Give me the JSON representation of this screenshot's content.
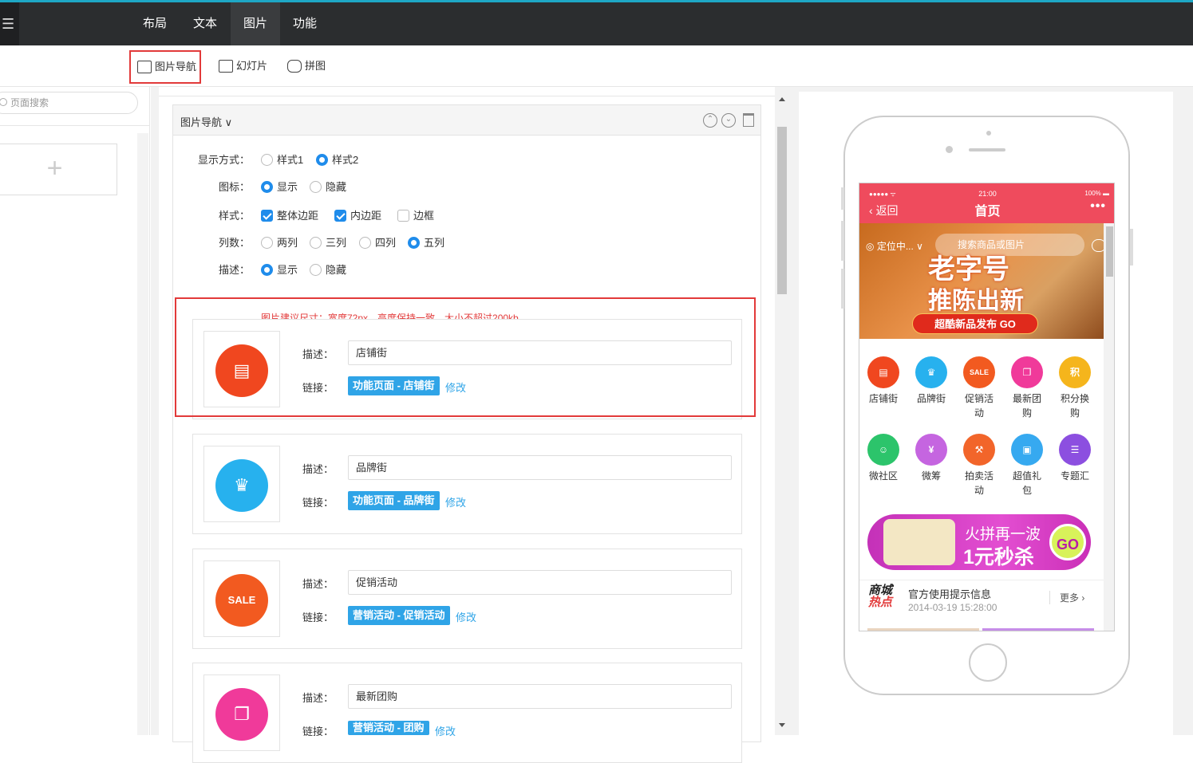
{
  "topbar": {
    "menu_icon": "list-icon",
    "tabs": [
      {
        "label": "布局"
      },
      {
        "label": "文本"
      },
      {
        "label": "图片"
      },
      {
        "label": "功能"
      }
    ],
    "active_tab": "图片"
  },
  "subbar": {
    "items": [
      {
        "label": "图片导航",
        "icon": "image-nav-icon"
      },
      {
        "label": "幻灯片",
        "icon": "slideshow-icon"
      },
      {
        "label": "拼图",
        "icon": "puzzle-icon"
      }
    ]
  },
  "left": {
    "search_placeholder": "页面搜索",
    "add_symbol": "+"
  },
  "panel": {
    "title": "图片导航",
    "rows": {
      "display_mode": {
        "label": "显示方式：",
        "options": [
          "样式1",
          "样式2"
        ],
        "selected": "样式2"
      },
      "icon": {
        "label": "图标：",
        "options": [
          "显示",
          "隐藏"
        ],
        "selected": "显示"
      },
      "style": {
        "label": "样式：",
        "options": [
          "整体边距",
          "内边距",
          "边框"
        ],
        "checked": [
          "整体边距",
          "内边距"
        ]
      },
      "columns": {
        "label": "列数：",
        "options": [
          "两列",
          "三列",
          "四列",
          "五列"
        ],
        "selected": "五列"
      },
      "desc": {
        "label": "描述：",
        "options": [
          "显示",
          "隐藏"
        ],
        "selected": "显示"
      }
    },
    "hint": "图片建议尺寸：宽度72px，高度保持一致，大小不超过200kb",
    "items": [
      {
        "desc_label": "描述：",
        "desc_value": "店铺街",
        "link_label": "链接：",
        "link_tag": "功能页面 - 店铺街",
        "edit": "修改",
        "color": "#f0471f",
        "icon": "store-icon",
        "glyph": "▤"
      },
      {
        "desc_label": "描述：",
        "desc_value": "品牌街",
        "link_label": "链接：",
        "link_tag": "功能页面 - 品牌街",
        "edit": "修改",
        "color": "#27b1ee",
        "icon": "crown-icon",
        "glyph": "♛"
      },
      {
        "desc_label": "描述：",
        "desc_value": "促销活动",
        "link_label": "链接：",
        "link_tag": "营销活动 - 促销活动",
        "edit": "修改",
        "color": "#f25a20",
        "icon": "sale-icon",
        "glyph": "SALE"
      },
      {
        "desc_label": "描述：",
        "desc_value": "最新团购",
        "link_label": "链接：",
        "link_tag": "营销活动 - 团购",
        "edit": "修改",
        "color": "#f03a9a",
        "icon": "groupbuy-icon",
        "glyph": "❐"
      }
    ]
  },
  "phone": {
    "status": {
      "signal": "●●●●● ᯤ",
      "time": "21:00",
      "battery": "100% ▬"
    },
    "back": "返回",
    "title": "首页",
    "more": "•••",
    "banner": {
      "location": "定位中...",
      "search_placeholder": "搜索商品或图片",
      "line1": "老字号",
      "line2": "推陈出新",
      "cta": "超酷新品发布 GO"
    },
    "nav": [
      {
        "label": "店铺街",
        "color": "#f0471f",
        "glyph": "▤"
      },
      {
        "label": "品牌街",
        "color": "#27b1ee",
        "glyph": "♛"
      },
      {
        "label": "促销活动",
        "color": "#f25a20",
        "glyph": "SALE"
      },
      {
        "label": "最新团购",
        "color": "#f03a9a",
        "glyph": "❐"
      },
      {
        "label": "积分换购",
        "color": "#f5b51c",
        "glyph": "积"
      },
      {
        "label": "微社区",
        "color": "#2cc46b",
        "glyph": "☺"
      },
      {
        "label": "微筹",
        "color": "#c565e0",
        "glyph": "¥"
      },
      {
        "label": "拍卖活动",
        "color": "#f2652a",
        "glyph": "⚒"
      },
      {
        "label": "超值礼包",
        "color": "#36a9f0",
        "glyph": "▣"
      },
      {
        "label": "专题汇",
        "color": "#8c4fe0",
        "glyph": "☰"
      }
    ],
    "promo": {
      "line1": "火拼再一波",
      "line2": "1元秒杀",
      "go": "GO"
    },
    "news": {
      "logo1": "商城",
      "logo2": "热点",
      "title": "官方使用提示信息",
      "date": "2014-03-19 15:28:00",
      "more": "更多 ›"
    }
  }
}
